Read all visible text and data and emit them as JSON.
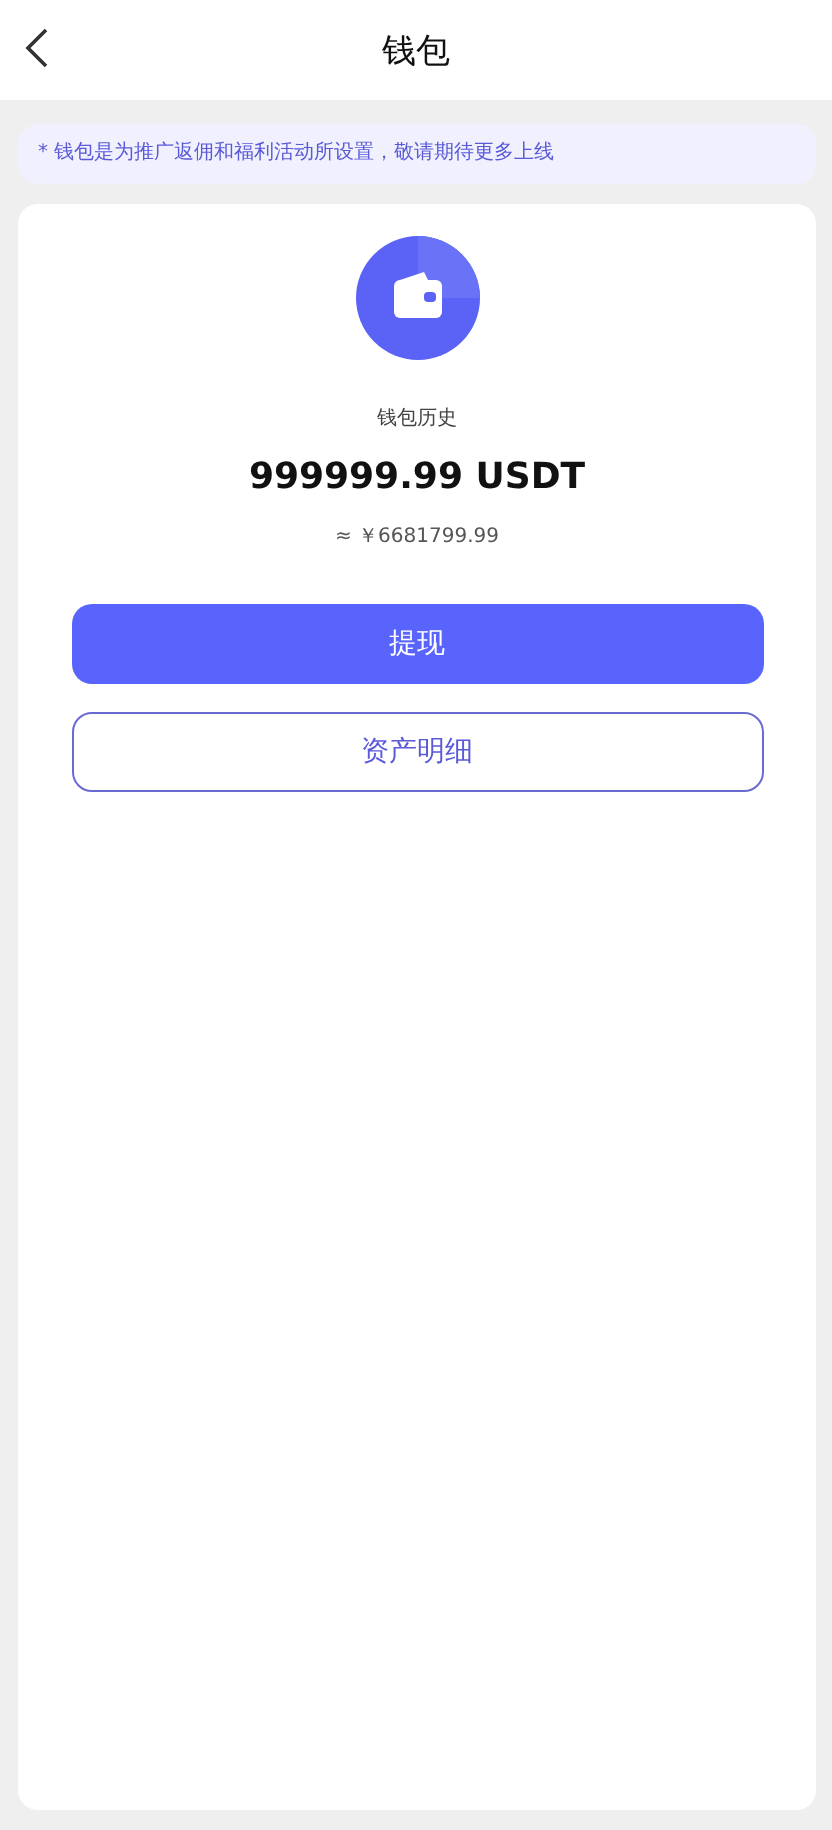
{
  "header": {
    "title": "钱包"
  },
  "notice": "* 钱包是为推广返佣和福利活动所设置，敬请期待更多上线",
  "wallet": {
    "label": "钱包历史",
    "amount": "999999.99 USDT",
    "approx": "≈ ￥6681799.99"
  },
  "buttons": [
    {
      "label": "提现",
      "kind": "primary"
    },
    {
      "label": "资产明细",
      "kind": "outline"
    }
  ]
}
